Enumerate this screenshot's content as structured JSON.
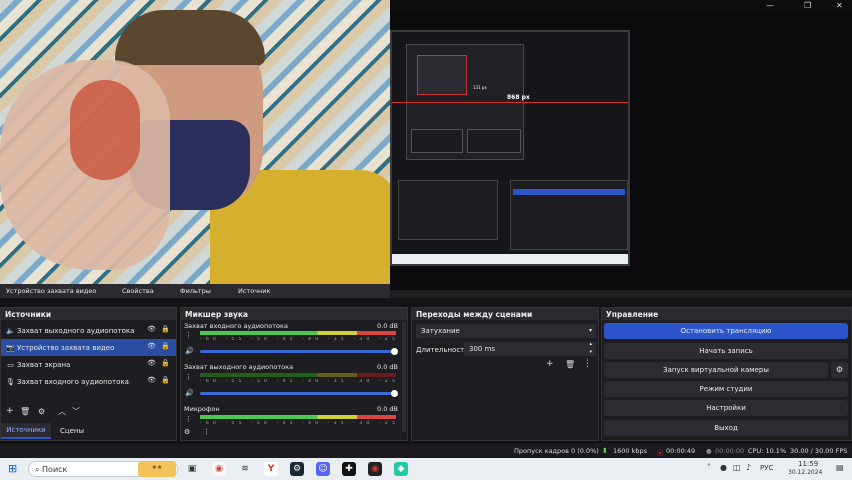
{
  "titlebar": {
    "minimize": "—",
    "maximize": "❐",
    "close": "✕"
  },
  "preview": {
    "measure_label": "868 px",
    "inner_measure": "131 px"
  },
  "source_toolbar": [
    "Устройство захвата видео",
    "Свойства",
    "Фильтры",
    "Источник"
  ],
  "docks": {
    "sources_title": "Источники",
    "mixer_title": "Микшер звука",
    "transitions_title": "Переходы между сценами",
    "controls_title": "Управление"
  },
  "sources": [
    {
      "icon": "speaker-icon",
      "label": "Захват выходного аудиопотока"
    },
    {
      "icon": "camera-icon",
      "label": "Устройство захвата видео"
    },
    {
      "icon": "monitor-icon",
      "label": "Захват экрана"
    },
    {
      "icon": "mic-icon",
      "label": "Захват входного аудиопотока"
    }
  ],
  "mixer": [
    {
      "name": "Захват входного аудиопотока",
      "db": "0.0 dB"
    },
    {
      "name": "Захват выходного аудиопотока",
      "db": "0.0 dB"
    },
    {
      "name": "Микрофон",
      "db": "0.0 dB"
    }
  ],
  "meter_ticks": "-60 -55 -50 -45 -40 -35 -30 -25 -20 -15 -10 -5 0",
  "transitions": {
    "selected": "Затухание",
    "duration_label": "Длительность",
    "duration_value": "300 ms"
  },
  "controls": {
    "stop_stream": "Остановить трансляцию",
    "start_record": "Начать запись",
    "virtual_cam": "Запуск виртуальной камеры",
    "studio_mode": "Режим студии",
    "settings": "Настройки",
    "exit": "Выход"
  },
  "bottom_tabs": {
    "sources": "Источники",
    "scenes": "Сцены"
  },
  "status": {
    "dropped": "Пропуск кадров 0 (0.0%)",
    "bitrate": "1600 kbps",
    "stream_time": "00:00:49",
    "rec_time": "00:00:00",
    "cpu": "CPU: 10.1%",
    "fps": "30.00 / 30.00 FPS"
  },
  "taskbar": {
    "search_placeholder": "Поиск",
    "lang": "РУС",
    "time": "11:59",
    "date": "30.12.2024"
  },
  "colors": {
    "accent": "#2b55c8",
    "selected_row": "#2b4ea3",
    "live_red": "#d9302c",
    "meter_green": "#4cc84c"
  }
}
